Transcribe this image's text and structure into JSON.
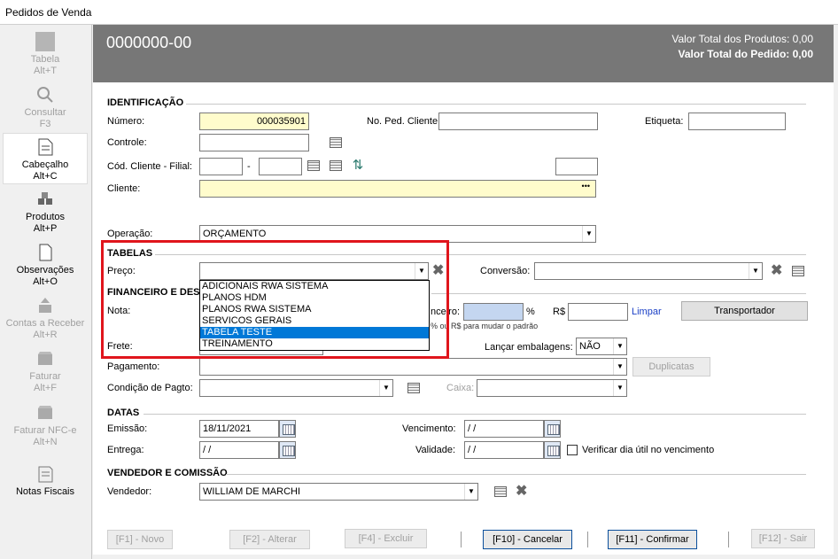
{
  "window": {
    "title": "Pedidos de Venda"
  },
  "sidebar": {
    "items": [
      {
        "label": "Tabela",
        "shortcut": "Alt+T",
        "icon": "table-icon",
        "state": "disabled"
      },
      {
        "label": "Consultar",
        "shortcut": "F3",
        "icon": "search-icon",
        "state": "disabled"
      },
      {
        "label": "Cabeçalho",
        "shortcut": "Alt+C",
        "icon": "document-icon",
        "state": "active"
      },
      {
        "label": "Produtos",
        "shortcut": "Alt+P",
        "icon": "boxes-icon",
        "state": "normal"
      },
      {
        "label": "Observações",
        "shortcut": "Alt+O",
        "icon": "note-icon",
        "state": "normal"
      },
      {
        "label": "Contas a Receber",
        "shortcut": "Alt+R",
        "icon": "receivable-icon",
        "state": "disabled"
      },
      {
        "label": "Faturar",
        "shortcut": "Alt+F",
        "icon": "invoice-icon",
        "state": "disabled"
      },
      {
        "label": "Faturar NFC-e",
        "shortcut": "Alt+N",
        "icon": "nfce-icon",
        "state": "disabled"
      },
      {
        "label": "Notas Fiscais",
        "shortcut": "",
        "icon": "fiscal-notes-icon",
        "state": "normal"
      }
    ]
  },
  "header": {
    "order_number": "0000000-00",
    "total_products": "Valor Total dos Produtos: 0,00",
    "total_order": "Valor Total do Pedido: 0,00",
    "bg_color": "#777777"
  },
  "identificacao": {
    "title": "IDENTIFICAÇÃO",
    "numero_label": "Número:",
    "numero_value": "000035901",
    "no_ped_cliente_label": "No. Ped. Cliente:",
    "etiqueta_label": "Etiqueta:",
    "controle_label": "Controle:",
    "cod_cliente_label": "Cód. Cliente - Filial:",
    "dash": "-",
    "cliente_label": "Cliente:",
    "cliente_dots": "•••",
    "operacao_label": "Operação:",
    "operacao_value": "ORÇAMENTO"
  },
  "tabelas": {
    "title": "TABELAS",
    "preco_label": "Preço:",
    "conversao_label": "Conversão:",
    "options": [
      "ADICIONAIS RWA SISTEMA",
      "PLANOS HDM",
      "PLANOS RWA SISTEMA",
      "SERVICOS GERAIS",
      "TABELA TESTE",
      "TREINAMENTO"
    ],
    "highlighted_option": "TABELA TESTE"
  },
  "financeiro": {
    "title": "FINANCEIRO E DESC",
    "nota_label": "Nota:",
    "financeiro_label": "nceiro:",
    "percent_label": "%",
    "rs_label": "R$",
    "limpar_link": "Limpar",
    "hint": "% ou R$ para mudar o padrão",
    "transportador_button": "Transportador",
    "frete_label": "Frete:",
    "lancar_embalagens_label": "Lançar embalagens:",
    "lancar_embalagens_value": "NÃO",
    "pagamento_label": "Pagamento:",
    "duplicatas_button": "Duplicatas",
    "condicao_label": "Condição de Pagto:",
    "caixa_label": "Caixa:"
  },
  "datas": {
    "title": "DATAS",
    "emissao_label": "Emissão:",
    "emissao_value": "18/11/2021",
    "vencimento_label": "Vencimento:",
    "vencimento_value": " /  /",
    "entrega_label": "Entrega:",
    "entrega_value": " /  /",
    "validade_label": "Validade:",
    "validade_value": " /  /",
    "verificar_label": "Verificar dia útil no vencimento"
  },
  "vendedor": {
    "title": "VENDEDOR E COMISSÃO",
    "vendedor_label": "Vendedor:",
    "vendedor_value": "WILLIAM DE MARCHI"
  },
  "footer": {
    "novo": "[F1] - Novo",
    "alterar": "[F2] - Alterar",
    "excluir": "[F4] - Excluir",
    "cancelar": "[F10] - Cancelar",
    "confirmar": "[F11] - Confirmar",
    "sair": "[F12] - Sair"
  },
  "highlight_color": "#e0151c"
}
